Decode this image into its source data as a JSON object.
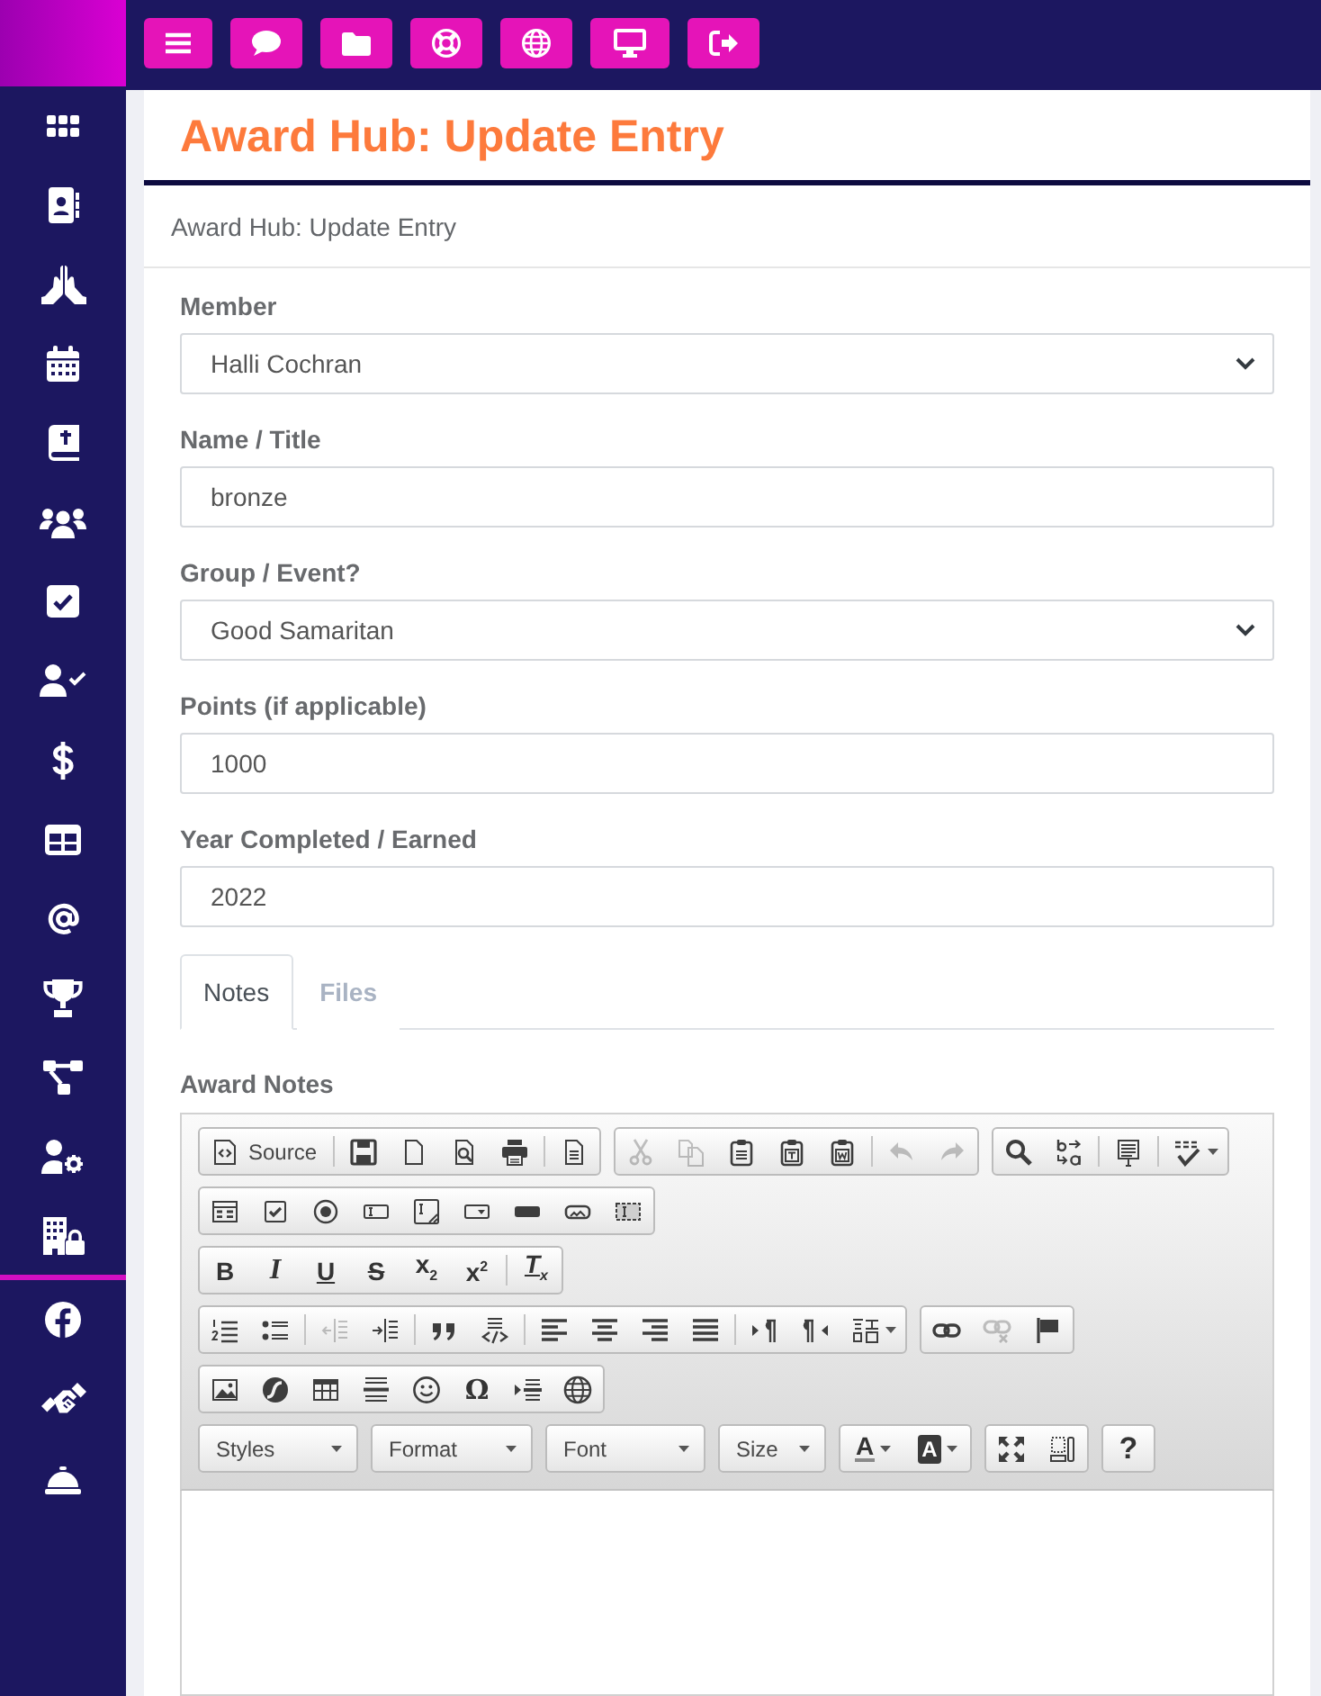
{
  "page": {
    "title": "Award Hub: Update Entry",
    "breadcrumb": "Award Hub: Update Entry"
  },
  "form": {
    "fields": [
      {
        "kind": "select",
        "label": "Member",
        "value": "Halli Cochran"
      },
      {
        "kind": "input",
        "label": "Name / Title",
        "value": "bronze"
      },
      {
        "kind": "select",
        "label": "Group / Event?",
        "value": "Good Samaritan"
      },
      {
        "kind": "input",
        "label": "Points (if applicable)",
        "value": "1000"
      },
      {
        "kind": "input",
        "label": "Year Completed / Earned",
        "value": "2022"
      }
    ]
  },
  "tabs": [
    {
      "label": "Notes",
      "selected": true
    },
    {
      "label": "Files",
      "selected": false
    }
  ],
  "editor": {
    "label": "Award Notes",
    "toolbar": [
      [
        [
          {
            "kind": "labeled",
            "label": "Source",
            "disabled": false
          },
          {
            "kind": "separator"
          },
          {
            "kind": "button",
            "disabled": false
          },
          {
            "kind": "button",
            "disabled": false
          },
          {
            "kind": "button",
            "disabled": false
          },
          {
            "kind": "button",
            "disabled": false
          },
          {
            "kind": "separator"
          },
          {
            "kind": "button",
            "disabled": false
          }
        ],
        [
          {
            "kind": "button",
            "disabled": true
          },
          {
            "kind": "button",
            "disabled": true
          },
          {
            "kind": "button",
            "disabled": false
          },
          {
            "kind": "button",
            "disabled": false
          },
          {
            "kind": "button",
            "disabled": false
          },
          {
            "kind": "separator"
          },
          {
            "kind": "button",
            "disabled": true
          },
          {
            "kind": "button",
            "disabled": true
          }
        ],
        [
          {
            "kind": "button",
            "disabled": false
          },
          {
            "kind": "button",
            "disabled": false
          },
          {
            "kind": "separator"
          },
          {
            "kind": "button",
            "disabled": false
          },
          {
            "kind": "separator"
          },
          {
            "kind": "menu",
            "disabled": false
          }
        ]
      ],
      [
        [
          {
            "kind": "button",
            "disabled": false
          },
          {
            "kind": "button",
            "disabled": false
          },
          {
            "kind": "button",
            "disabled": false
          },
          {
            "kind": "button",
            "disabled": false
          },
          {
            "kind": "button",
            "disabled": false
          },
          {
            "kind": "button",
            "disabled": false
          },
          {
            "kind": "button",
            "disabled": false
          },
          {
            "kind": "button",
            "disabled": false
          },
          {
            "kind": "button",
            "disabled": false
          }
        ]
      ],
      [
        [
          {
            "kind": "text",
            "label": "B",
            "disabled": false
          },
          {
            "kind": "text",
            "label": "I",
            "disabled": false
          },
          {
            "kind": "text",
            "label": "U",
            "disabled": false
          },
          {
            "kind": "text",
            "label": "S",
            "disabled": false
          },
          {
            "kind": "text",
            "label": "x$_{2}$",
            "disabled": false
          },
          {
            "kind": "text",
            "label": "x$^{2}$",
            "disabled": false
          },
          {
            "kind": "separator"
          },
          {
            "kind": "text",
            "label": "T$_{x}$",
            "disabled": false
          }
        ]
      ],
      [
        [
          {
            "kind": "button",
            "disabled": false
          },
          {
            "kind": "button",
            "disabled": false
          },
          {
            "kind": "separator"
          },
          {
            "kind": "button",
            "disabled": true
          },
          {
            "kind": "button",
            "disabled": false
          },
          {
            "kind": "separator"
          },
          {
            "kind": "button",
            "disabled": false
          },
          {
            "kind": "button",
            "disabled": false
          },
          {
            "kind": "separator"
          },
          {
            "kind": "button",
            "disabled": false
          },
          {
            "kind": "button",
            "disabled": false
          },
          {
            "kind": "button",
            "disabled": false
          },
          {
            "kind": "button",
            "disabled": false
          },
          {
            "kind": "separator"
          },
          {
            "kind": "button",
            "disabled": false
          },
          {
            "kind": "button",
            "disabled": false
          },
          {
            "kind": "menu",
            "disabled": false
          }
        ],
        [
          {
            "kind": "button",
            "disabled": false
          },
          {
            "kind": "button",
            "disabled": true
          },
          {
            "kind": "button",
            "disabled": false
          }
        ]
      ],
      [
        [
          {
            "kind": "button",
            "disabled": false
          },
          {
            "kind": "button",
            "disabled": false
          },
          {
            "kind": "button",
            "disabled": false
          },
          {
            "kind": "button",
            "disabled": false
          },
          {
            "kind": "button",
            "disabled": false
          },
          {
            "kind": "text",
            "label": "Ω",
            "disabled": false
          },
          {
            "kind": "button",
            "disabled": false
          },
          {
            "kind": "button",
            "disabled": false
          }
        ]
      ],
      [
        [
          {
            "kind": "combo",
            "label": "Styles"
          }
        ],
        [
          {
            "kind": "combo",
            "label": "Format"
          }
        ],
        [
          {
            "kind": "combo",
            "label": "Font"
          }
        ],
        [
          {
            "kind": "combo",
            "label": "Size"
          }
        ],
        [
          {
            "kind": "textmenu",
            "label": "A",
            "disabled": false
          },
          {
            "kind": "textmenu",
            "label": "A",
            "disabled": false
          }
        ],
        [
          {
            "kind": "button",
            "disabled": false
          },
          {
            "kind": "button",
            "disabled": false
          }
        ],
        [
          {
            "kind": "text",
            "label": "?",
            "disabled": false
          }
        ]
      ]
    ]
  }
}
